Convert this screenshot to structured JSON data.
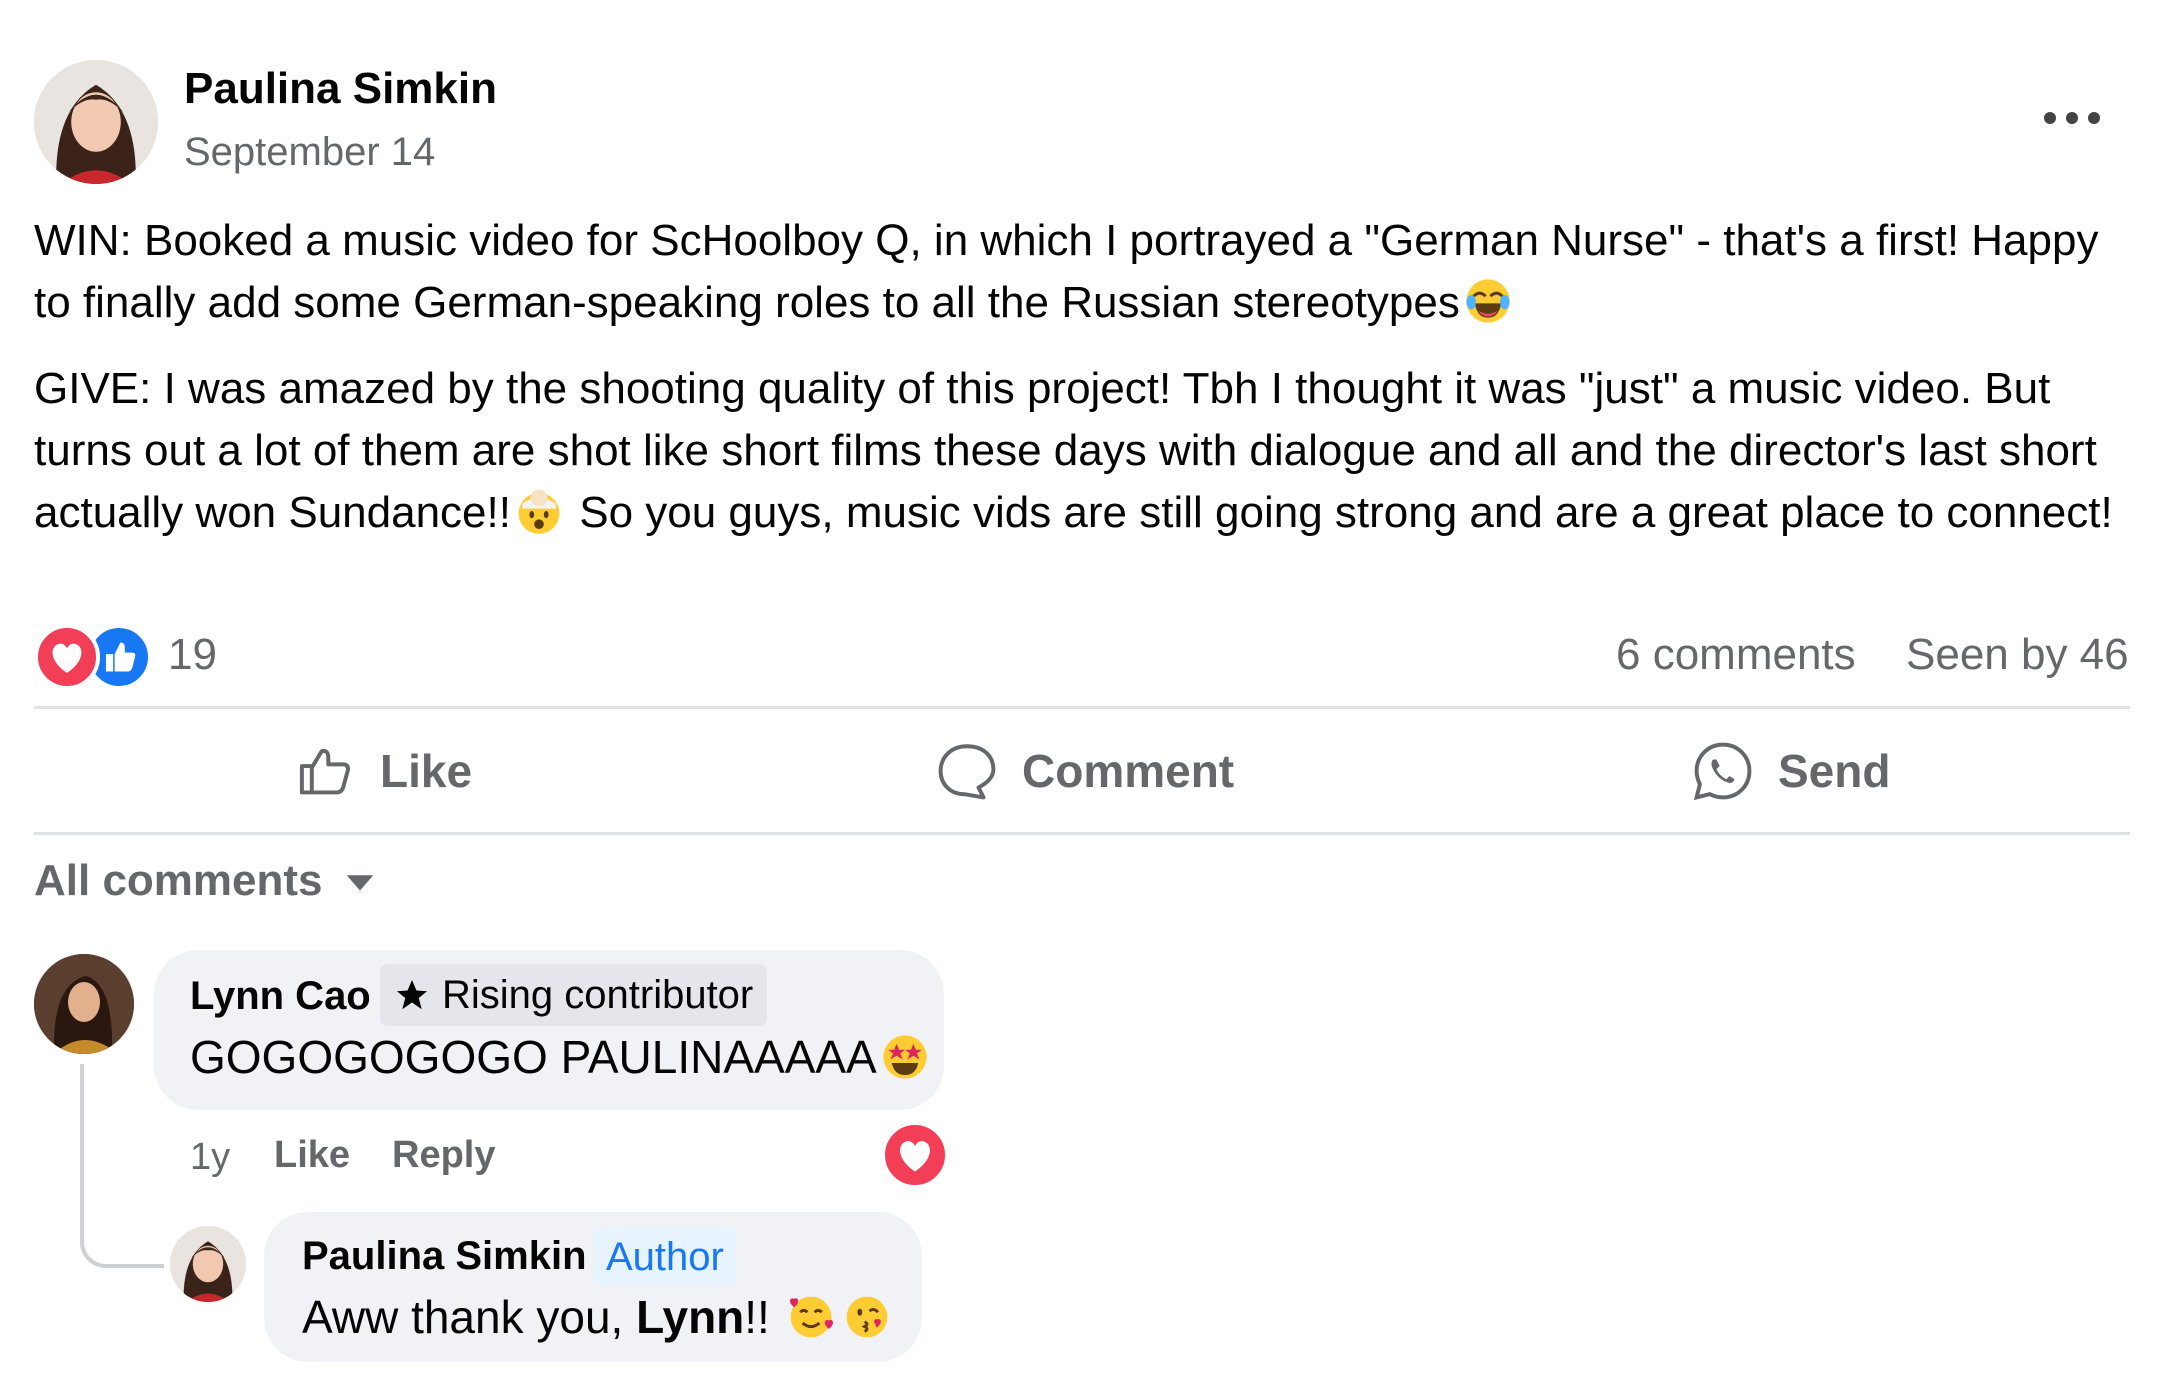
{
  "post": {
    "author": "Paulina Simkin",
    "date": "September 14",
    "body": {
      "win": "WIN: Booked a music video for ScHoolboy Q, in which I portrayed a \"German Nurse\" - that's a first! Happy to finally add some German-speaking roles to all the Russian stereotypes",
      "give_part1": "GIVE: I was amazed by the shooting quality of this project! Tbh I thought it was \"just\" a music video. But turns out a lot of them are shot like short films these days with dialogue and all and the director's last short actually won Sundance!!",
      "give_part2": "So you guys, music vids are still going strong and are a great place to connect!"
    },
    "emojis": {
      "win_end": "laughing-tears-emoji",
      "give_mid": "mind-blown-emoji"
    },
    "reactions": {
      "types": [
        "love",
        "like"
      ],
      "count": "19",
      "comments": "6 comments",
      "seen_by": "Seen by 46"
    },
    "actions": {
      "like": "Like",
      "comment": "Comment",
      "send": "Send"
    }
  },
  "comments_filter": "All comments",
  "comments": [
    {
      "author": "Lynn Cao",
      "badge": "Rising contributor",
      "text": "GOGOGOGOGO PAULINAAAAA",
      "emoji": "star-struck-emoji",
      "time": "1y",
      "like_label": "Like",
      "reply_label": "Reply",
      "reaction": "love",
      "replies": [
        {
          "author": "Paulina Simkin",
          "badge": "Author",
          "text_prefix": "Aww thank you,",
          "mention": "Lynn",
          "text_suffix": "!!",
          "emojis": [
            "smiling-hearts-emoji",
            "kissing-emoji"
          ]
        }
      ]
    }
  ],
  "colors": {
    "accent": "#1877f2",
    "love": "#f33e58",
    "secondary_text": "#65676b",
    "bubble": "#f0f2f5"
  }
}
